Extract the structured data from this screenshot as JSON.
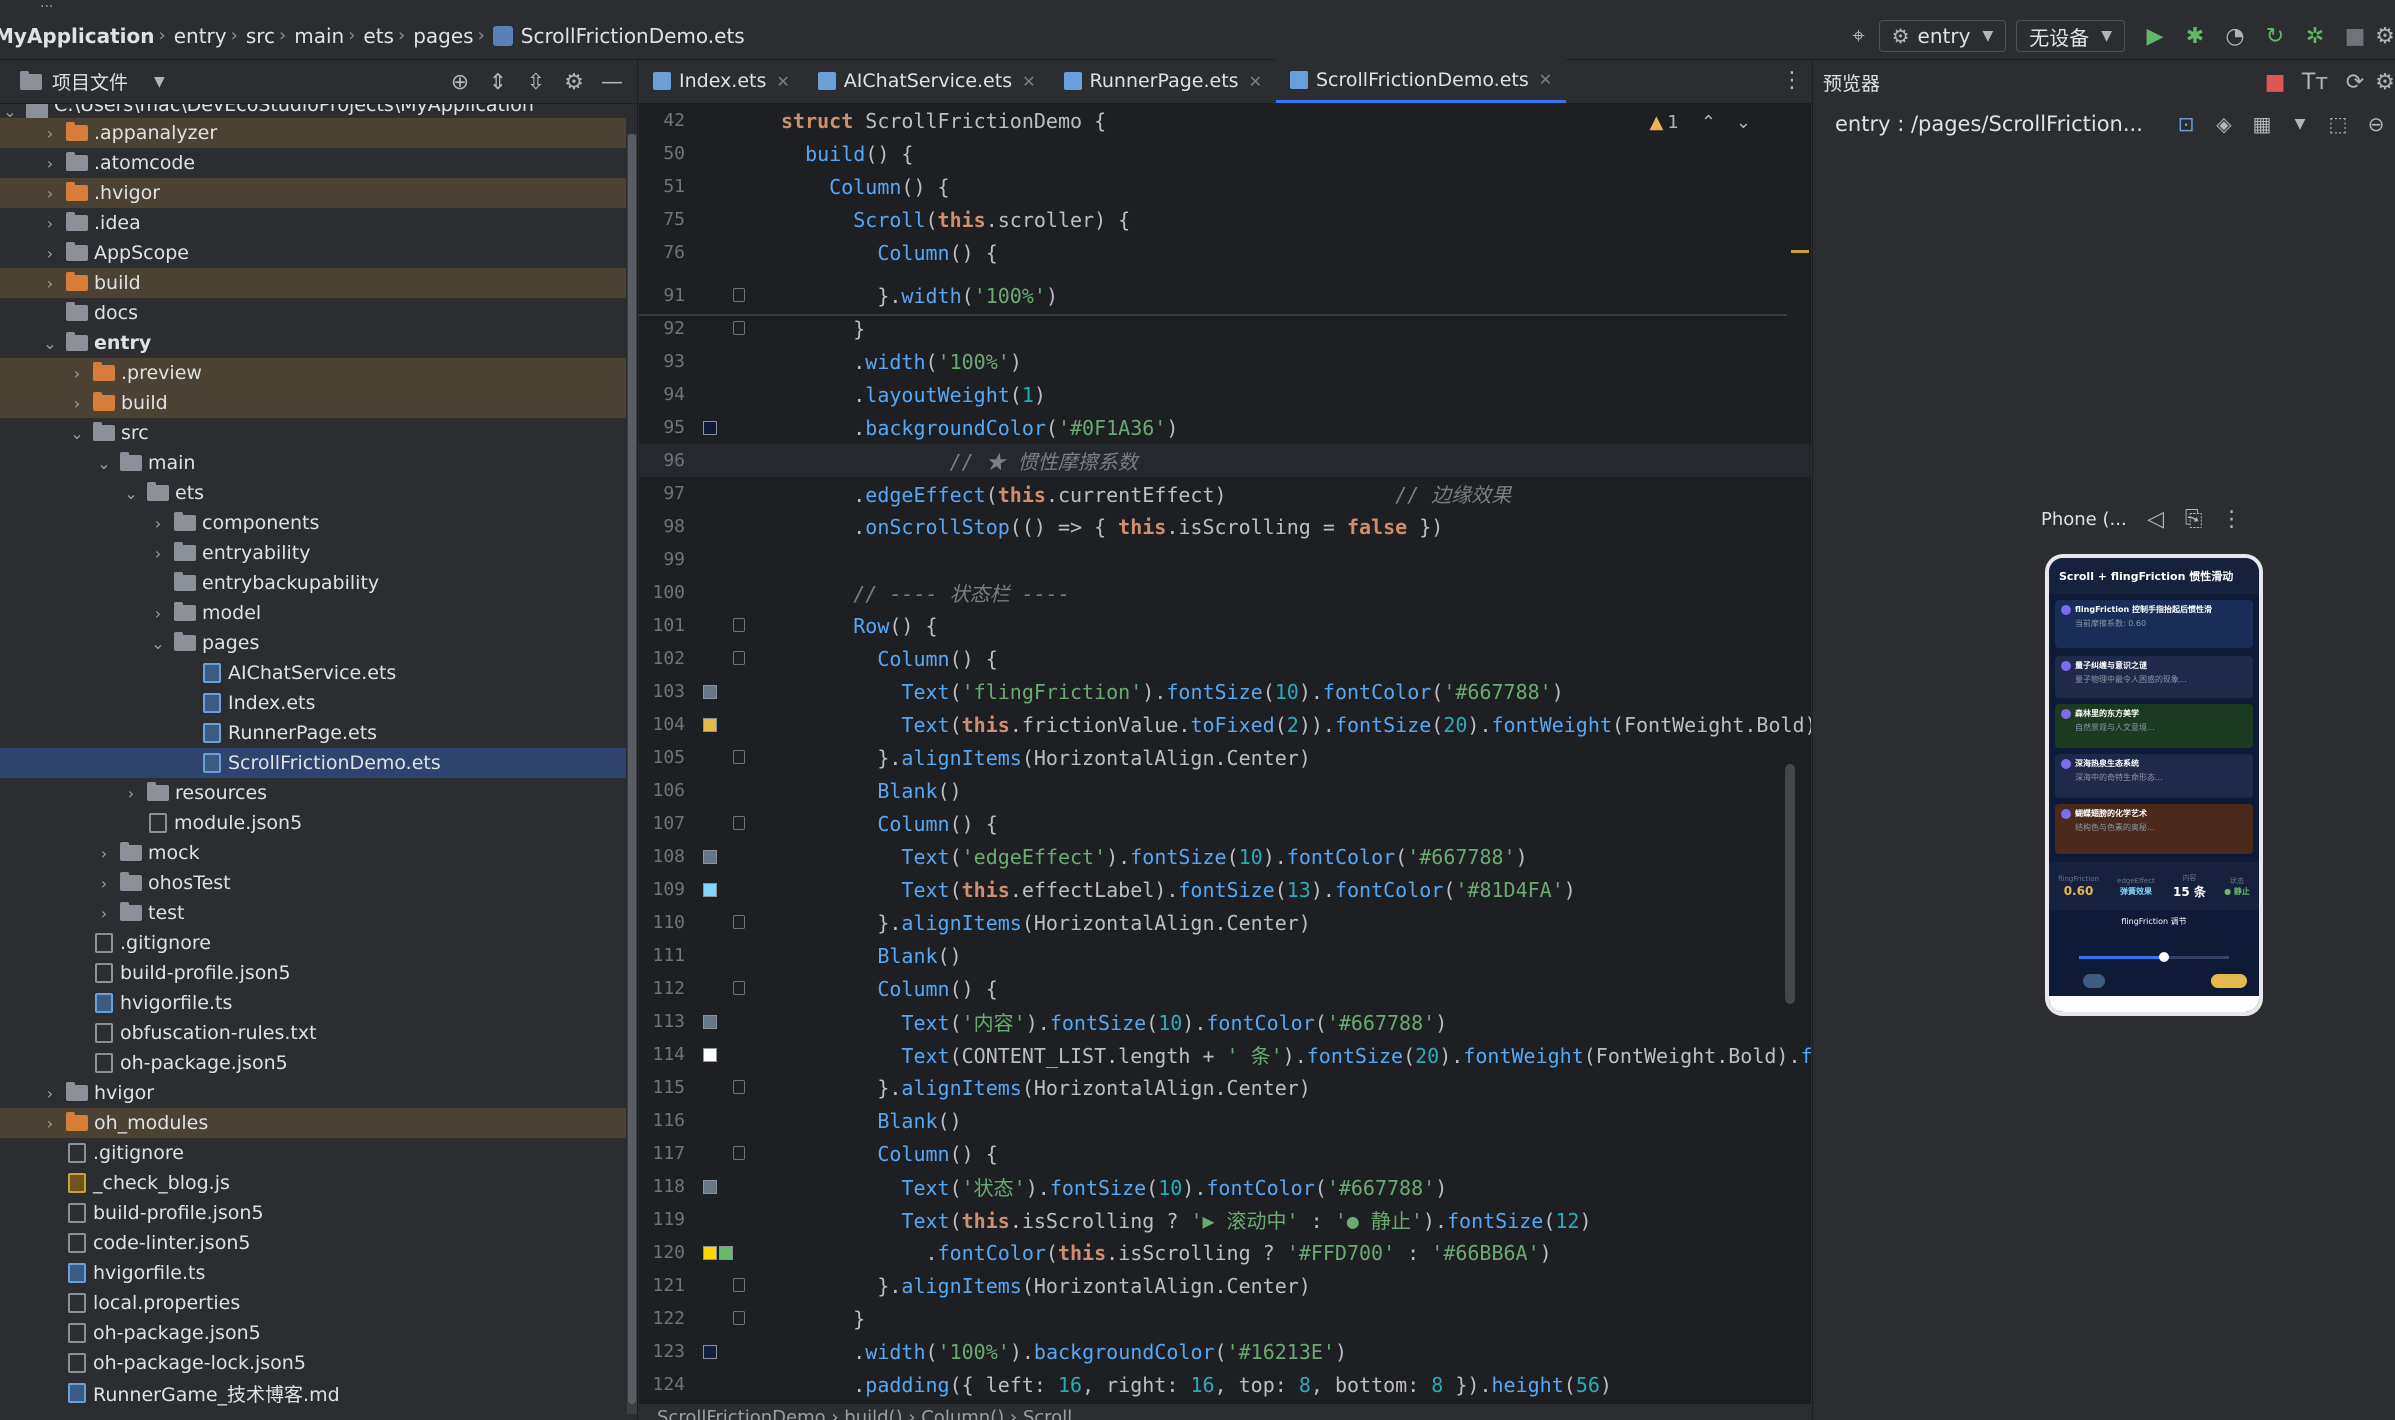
{
  "navbar": {
    "breadcrumb": [
      "MyApplication",
      "entry",
      "src",
      "main",
      "ets",
      "pages",
      "ScrollFrictionDemo.ets"
    ],
    "run_config": "entry",
    "device": "无设备"
  },
  "project": {
    "title": "项目文件",
    "root_path": "C:\\Users\\mac\\DevEcoStudioProjects\\MyApplication",
    "tree": [
      {
        "label": ".appanalyzer",
        "depth": 1,
        "type": "folder",
        "color": "orange",
        "arrow": "›",
        "hl": true
      },
      {
        "label": ".atomcode",
        "depth": 1,
        "type": "folder",
        "color": "gray",
        "arrow": "›"
      },
      {
        "label": ".hvigor",
        "depth": 1,
        "type": "folder",
        "color": "orange",
        "arrow": "›",
        "hl": true
      },
      {
        "label": ".idea",
        "depth": 1,
        "type": "folder",
        "color": "gray",
        "arrow": "›"
      },
      {
        "label": "AppScope",
        "depth": 1,
        "type": "folder",
        "color": "gray",
        "arrow": "›"
      },
      {
        "label": "build",
        "depth": 1,
        "type": "folder",
        "color": "orange",
        "arrow": "›",
        "hl": true
      },
      {
        "label": "docs",
        "depth": 1,
        "type": "folder",
        "color": "gray",
        "arrow": ""
      },
      {
        "label": "entry",
        "depth": 1,
        "type": "folder",
        "color": "gray",
        "arrow": "⌄",
        "bold": true
      },
      {
        "label": ".preview",
        "depth": 2,
        "type": "folder",
        "color": "orange",
        "arrow": "›",
        "hl": true
      },
      {
        "label": "build",
        "depth": 2,
        "type": "folder",
        "color": "orange",
        "arrow": "›",
        "hl": true
      },
      {
        "label": "src",
        "depth": 2,
        "type": "folder",
        "color": "gray",
        "arrow": "⌄"
      },
      {
        "label": "main",
        "depth": 3,
        "type": "folder",
        "color": "gray",
        "arrow": "⌄"
      },
      {
        "label": "ets",
        "depth": 4,
        "type": "folder",
        "color": "gray",
        "arrow": "⌄"
      },
      {
        "label": "components",
        "depth": 5,
        "type": "folder",
        "color": "gray",
        "arrow": "›"
      },
      {
        "label": "entryability",
        "depth": 5,
        "type": "folder",
        "color": "gray",
        "arrow": "›"
      },
      {
        "label": "entrybackupability",
        "depth": 5,
        "type": "folder",
        "color": "gray",
        "arrow": ""
      },
      {
        "label": "model",
        "depth": 5,
        "type": "folder",
        "color": "gray",
        "arrow": "›"
      },
      {
        "label": "pages",
        "depth": 5,
        "type": "folder",
        "color": "gray",
        "arrow": "⌄"
      },
      {
        "label": "AIChatService.ets",
        "depth": 6,
        "type": "file",
        "color": "blue",
        "arrow": ""
      },
      {
        "label": "Index.ets",
        "depth": 6,
        "type": "file",
        "color": "blue",
        "arrow": ""
      },
      {
        "label": "RunnerPage.ets",
        "depth": 6,
        "type": "file",
        "color": "blue",
        "arrow": ""
      },
      {
        "label": "ScrollFrictionDemo.ets",
        "depth": 6,
        "type": "file",
        "color": "blue",
        "arrow": "",
        "sel": true
      },
      {
        "label": "resources",
        "depth": 4,
        "type": "folder",
        "color": "gray",
        "arrow": "›"
      },
      {
        "label": "module.json5",
        "depth": 4,
        "type": "file",
        "color": "gray",
        "arrow": ""
      },
      {
        "label": "mock",
        "depth": 3,
        "type": "folder",
        "color": "gray",
        "arrow": "›"
      },
      {
        "label": "ohosTest",
        "depth": 3,
        "type": "folder",
        "color": "gray",
        "arrow": "›"
      },
      {
        "label": "test",
        "depth": 3,
        "type": "folder",
        "color": "gray",
        "arrow": "›"
      },
      {
        "label": ".gitignore",
        "depth": 2,
        "type": "file",
        "color": "gray",
        "arrow": ""
      },
      {
        "label": "build-profile.json5",
        "depth": 2,
        "type": "file",
        "color": "gray",
        "arrow": ""
      },
      {
        "label": "hvigorfile.ts",
        "depth": 2,
        "type": "file",
        "color": "blue",
        "arrow": ""
      },
      {
        "label": "obfuscation-rules.txt",
        "depth": 2,
        "type": "file",
        "color": "gray",
        "arrow": ""
      },
      {
        "label": "oh-package.json5",
        "depth": 2,
        "type": "file",
        "color": "gray",
        "arrow": ""
      },
      {
        "label": "hvigor",
        "depth": 1,
        "type": "folder",
        "color": "gray",
        "arrow": "›"
      },
      {
        "label": "oh_modules",
        "depth": 1,
        "type": "folder",
        "color": "orange",
        "arrow": "›",
        "hl": true
      },
      {
        "label": ".gitignore",
        "depth": 1,
        "type": "file",
        "color": "gray",
        "arrow": ""
      },
      {
        "label": "_check_blog.js",
        "depth": 1,
        "type": "file",
        "color": "js",
        "arrow": ""
      },
      {
        "label": "build-profile.json5",
        "depth": 1,
        "type": "file",
        "color": "gray",
        "arrow": ""
      },
      {
        "label": "code-linter.json5",
        "depth": 1,
        "type": "file",
        "color": "gray",
        "arrow": ""
      },
      {
        "label": "hvigorfile.ts",
        "depth": 1,
        "type": "file",
        "color": "blue",
        "arrow": ""
      },
      {
        "label": "local.properties",
        "depth": 1,
        "type": "file",
        "color": "gray",
        "arrow": ""
      },
      {
        "label": "oh-package.json5",
        "depth": 1,
        "type": "file",
        "color": "gray",
        "arrow": ""
      },
      {
        "label": "oh-package-lock.json5",
        "depth": 1,
        "type": "file",
        "color": "gray",
        "arrow": ""
      },
      {
        "label": "RunnerGame_技术博客.md",
        "depth": 1,
        "type": "file",
        "color": "blue",
        "arrow": ""
      }
    ]
  },
  "editor": {
    "tabs": [
      {
        "label": "Index.ets",
        "active": false
      },
      {
        "label": "AIChatService.ets",
        "active": false
      },
      {
        "label": "RunnerPage.ets",
        "active": false
      },
      {
        "label": "ScrollFrictionDemo.ets",
        "active": true
      }
    ],
    "warning_count": "1",
    "lines": [
      {
        "n": "42",
        "html": "<span class='kwb'>struct</span> <span style='color:#bcbec4'>ScrollFrictionDemo</span> {",
        "sticky": true
      },
      {
        "n": "50",
        "html": "  <span class='fn'>build</span>() {",
        "sticky": true
      },
      {
        "n": "51",
        "html": "    <span class='fn'>Column</span>() {",
        "sticky": true
      },
      {
        "n": "75",
        "html": "      <span class='fn'>Scroll</span>(<span class='kwb'>this</span>.scroller) {",
        "sticky": true
      },
      {
        "n": "76",
        "html": "        <span class='fn'>Column</span>() {",
        "sticky": true
      },
      {
        "n": "91",
        "html": "        }.<span class='fn'>width</span>(<span class='str'>'100%'</span>)",
        "fold": true
      },
      {
        "n": "92",
        "html": "      }",
        "fold": true
      },
      {
        "n": "93",
        "html": "      .<span class='fn'>width</span>(<span class='str'>'100%'</span>)"
      },
      {
        "n": "94",
        "html": "      .<span class='fn'>layoutWeight</span>(<span class='num'>1</span>)"
      },
      {
        "n": "95",
        "html": "      .<span class='fn'>backgroundColor</span>(<span class='str'>'#0F1A36'</span>)",
        "swatch": [
          "#0F1A36"
        ]
      },
      {
        "n": "96",
        "html": "              <span class='cmt'>// ★ 惯性摩擦系数</span>",
        "cur": true
      },
      {
        "n": "97",
        "html": "      .<span class='fn'>edgeEffect</span>(<span class='kwb'>this</span>.currentEffect)              <span class='cmt'>// 边缘效果</span>"
      },
      {
        "n": "98",
        "html": "      .<span class='fn'>onScrollStop</span>(() => { <span class='kwb'>this</span>.isScrolling = <span class='kwb'>false</span> })"
      },
      {
        "n": "99",
        "html": ""
      },
      {
        "n": "100",
        "html": "      <span class='cmt'>// ---- 状态栏 ----</span>"
      },
      {
        "n": "101",
        "html": "      <span class='fn'>Row</span>() {",
        "fold": true
      },
      {
        "n": "102",
        "html": "        <span class='fn'>Column</span>() {",
        "fold": true
      },
      {
        "n": "103",
        "html": "          <span class='fn'>Text</span>(<span class='str'>'flingFriction'</span>).<span class='fn'>fontSize</span>(<span class='num'>10</span>).<span class='fn'>fontColor</span>(<span class='str'>'#667788'</span>)",
        "swatch": [
          "#667788"
        ]
      },
      {
        "n": "104",
        "html": "          <span class='fn'>Text</span>(<span class='kwb'>this</span>.frictionValue.<span class='fn'>toFixed</span>(<span class='num'>2</span>)).<span class='fn'>fontSize</span>(<span class='num'>20</span>).<span class='fn'>fontWeight</span>(FontWeight.Bold).<span class='fn'>f</span>",
        "swatch": [
          "#E5B84B"
        ]
      },
      {
        "n": "105",
        "html": "        }.<span class='fn'>alignItems</span>(HorizontalAlign.Center)",
        "fold": true
      },
      {
        "n": "106",
        "html": "        <span class='fn'>Blank</span>()"
      },
      {
        "n": "107",
        "html": "        <span class='fn'>Column</span>() {",
        "fold": true
      },
      {
        "n": "108",
        "html": "          <span class='fn'>Text</span>(<span class='str'>'edgeEffect'</span>).<span class='fn'>fontSize</span>(<span class='num'>10</span>).<span class='fn'>fontColor</span>(<span class='str'>'#667788'</span>)",
        "swatch": [
          "#667788"
        ]
      },
      {
        "n": "109",
        "html": "          <span class='fn'>Text</span>(<span class='kwb'>this</span>.effectLabel).<span class='fn'>fontSize</span>(<span class='num'>13</span>).<span class='fn'>fontColor</span>(<span class='str'>'#81D4FA'</span>)",
        "swatch": [
          "#81D4FA"
        ]
      },
      {
        "n": "110",
        "html": "        }.<span class='fn'>alignItems</span>(HorizontalAlign.Center)",
        "fold": true
      },
      {
        "n": "111",
        "html": "        <span class='fn'>Blank</span>()"
      },
      {
        "n": "112",
        "html": "        <span class='fn'>Column</span>() {",
        "fold": true
      },
      {
        "n": "113",
        "html": "          <span class='fn'>Text</span>(<span class='str'>'内容'</span>).<span class='fn'>fontSize</span>(<span class='num'>10</span>).<span class='fn'>fontColor</span>(<span class='str'>'#667788'</span>)",
        "swatch": [
          "#667788"
        ]
      },
      {
        "n": "114",
        "html": "          <span class='fn'>Text</span>(CONTENT_LIST.length + <span class='str'>' 条'</span>).<span class='fn'>fontSize</span>(<span class='num'>20</span>).<span class='fn'>fontWeight</span>(FontWeight.Bold).<span class='fn'>fon</span>",
        "swatch": [
          "#FFFFFF"
        ]
      },
      {
        "n": "115",
        "html": "        }.<span class='fn'>alignItems</span>(HorizontalAlign.Center)",
        "fold": true
      },
      {
        "n": "116",
        "html": "        <span class='fn'>Blank</span>()"
      },
      {
        "n": "117",
        "html": "        <span class='fn'>Column</span>() {",
        "fold": true
      },
      {
        "n": "118",
        "html": "          <span class='fn'>Text</span>(<span class='str'>'状态'</span>).<span class='fn'>fontSize</span>(<span class='num'>10</span>).<span class='fn'>fontColor</span>(<span class='str'>'#667788'</span>)",
        "swatch": [
          "#667788"
        ]
      },
      {
        "n": "119",
        "html": "          <span class='fn'>Text</span>(<span class='kwb'>this</span>.isScrolling ? <span class='str'>'▶ 滚动中'</span> : <span class='str'>'● 静止'</span>).<span class='fn'>fontSize</span>(<span class='num'>12</span>)"
      },
      {
        "n": "120",
        "html": "            .<span class='fn'>fontColor</span>(<span class='kwb'>this</span>.isScrolling ? <span class='str'>'#FFD700'</span> : <span class='str'>'#66BB6A'</span>)",
        "swatch": [
          "#FFD700",
          "#66BB6A"
        ]
      },
      {
        "n": "121",
        "html": "        }.<span class='fn'>alignItems</span>(HorizontalAlign.Center)",
        "fold": true
      },
      {
        "n": "122",
        "html": "      }",
        "fold": true
      },
      {
        "n": "123",
        "html": "      .<span class='fn'>width</span>(<span class='str'>'100%'</span>).<span class='fn'>backgroundColor</span>(<span class='str'>'#16213E'</span>)",
        "swatch": [
          "#16213E"
        ]
      },
      {
        "n": "124",
        "html": "      .<span class='fn'>padding</span>({ left: <span class='num'>16</span>, right: <span class='num'>16</span>, top: <span class='num'>8</span>, bottom: <span class='num'>8</span> }).<span class='fn'>height</span>(<span class='num'>56</span>)"
      }
    ],
    "bottom_crumbs": "ScrollFrictionDemo  ›  build()  ›  Column()  ›  Scroll"
  },
  "preview": {
    "title": "预览器",
    "path": "entry : /pages/ScrollFriction...",
    "device": "Phone (...",
    "phone": {
      "title": "Scroll + flingFriction 惯性滑动",
      "cards": [
        {
          "title": "flingFriction 控制手指抬起后惯性滑",
          "sub": "当前摩擦系数: 0.60"
        },
        {
          "title": "量子纠缠与意识之谜",
          "sub": "量子物理中最令人困惑的现象..."
        },
        {
          "title": "森林里的东方美学",
          "sub": "自然景观与人文意境..."
        },
        {
          "title": "深海热泉生态系统",
          "sub": "深海中的奇特生命形态..."
        },
        {
          "title": "蝴蝶翅膀的化学艺术",
          "sub": "结构色与色素的奥秘..."
        }
      ],
      "status": [
        {
          "k": "flingFriction",
          "v": "0.60"
        },
        {
          "k": "edgeEffect",
          "v": "弹簧效果"
        },
        {
          "k": "内容",
          "v": "15 条"
        },
        {
          "k": "状态",
          "v": "● 静止"
        }
      ],
      "ctrl_title": "flingFriction 调节"
    }
  },
  "colors": {
    "accent": "#3574f0",
    "selection": "#2e436e"
  }
}
